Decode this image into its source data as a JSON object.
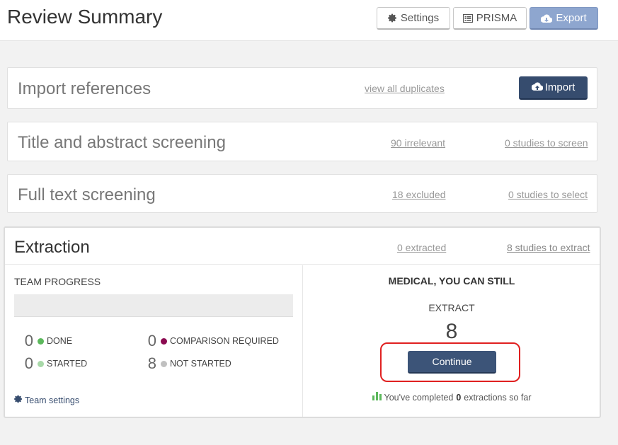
{
  "header": {
    "title": "Review Summary",
    "buttons": {
      "settings": "Settings",
      "prisma": "PRISMA",
      "export": "Export"
    }
  },
  "import_panel": {
    "title": "Import references",
    "duplicates_link": "view all duplicates",
    "import_button": "Import"
  },
  "title_abstract_panel": {
    "title": "Title and abstract screening",
    "irrelevant_link": "90 irrelevant",
    "to_screen_link": "0 studies to screen"
  },
  "full_text_panel": {
    "title": "Full text screening",
    "excluded_link": "18 excluded",
    "to_select_link": "0 studies to select"
  },
  "extraction_panel": {
    "title": "Extraction",
    "extracted_link": "0 extracted",
    "to_extract_link": "8 studies to extract",
    "team_progress": {
      "label": "TEAM PROGRESS",
      "progress_fraction": 0,
      "stats": {
        "done": {
          "count": "0",
          "label": "DONE",
          "color": "#5cb85c"
        },
        "started": {
          "count": "0",
          "label": "STARTED",
          "color": "#a8d8a8"
        },
        "comparison_required": {
          "count": "0",
          "label": "COMPARISON REQUIRED",
          "color": "#8b0a50"
        },
        "not_started": {
          "count": "8",
          "label": "NOT STARTED",
          "color": "#c0c0c0"
        }
      },
      "team_settings_link": "Team settings"
    },
    "user_prompt": {
      "line1": "MEDICAL, YOU CAN STILL",
      "line2": "EXTRACT",
      "count": "8",
      "continue_button": "Continue",
      "completed_prefix": "You've completed",
      "completed_count": "0",
      "completed_suffix": "extractions so far"
    }
  },
  "colors": {
    "accent": "#364c6e",
    "export_button": "#8ea6cf",
    "highlight": "#e02020"
  }
}
